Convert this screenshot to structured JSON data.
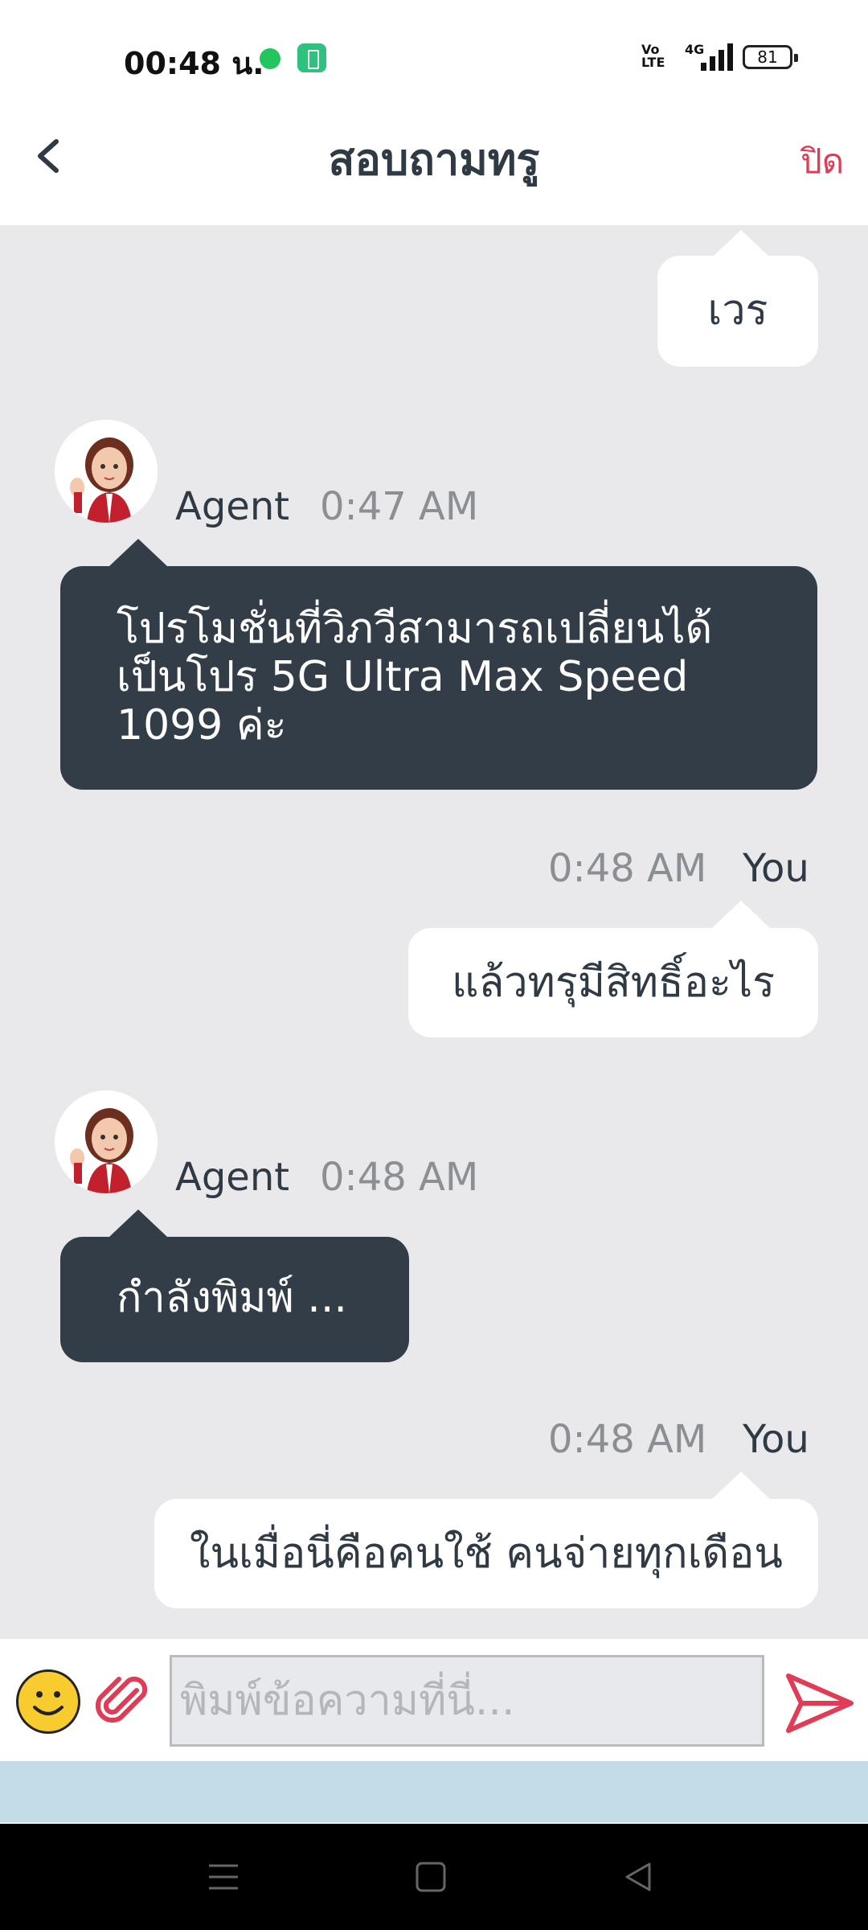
{
  "status_bar": {
    "time": "00:48 น.",
    "network": "4G",
    "volte": "Vo LTE",
    "battery": "81"
  },
  "header": {
    "title": "สอบถามทรู",
    "close_label": "ปิด"
  },
  "messages": [
    {
      "from": "You",
      "text": "เวร"
    },
    {
      "from": "Agent",
      "sender": "Agent",
      "time": "0:47  AM",
      "text": "โปรโมชั่นที่วิภวีสามารถเปลี่ยนได้ เป็นโปร 5G Ultra Max Speed 1099 ค่ะ"
    },
    {
      "from": "You",
      "sender": "You",
      "time": "0:48  AM",
      "text": "แล้วทรุมีสิทธิ์อะไร"
    },
    {
      "from": "Agent",
      "sender": "Agent",
      "time": "0:48  AM",
      "text": "กำลังพิมพ์ ..."
    },
    {
      "from": "You",
      "sender": "You",
      "time": "0:48  AM",
      "text": "ในเมื่อนี่คือคนใช้ คนจ่ายทุกเดือน"
    }
  ],
  "composer": {
    "placeholder": "พิมพ์ข้อความที่นี่...",
    "icons": [
      "emoji-icon",
      "attachment-icon",
      "send-icon"
    ]
  },
  "nav_icons": [
    "menu-icon",
    "home-square-icon",
    "back-triangle-icon"
  ],
  "colors": {
    "accent": "#e23b55",
    "agent_bubble": "#323d47",
    "chat_bg": "#e9e9ec"
  }
}
